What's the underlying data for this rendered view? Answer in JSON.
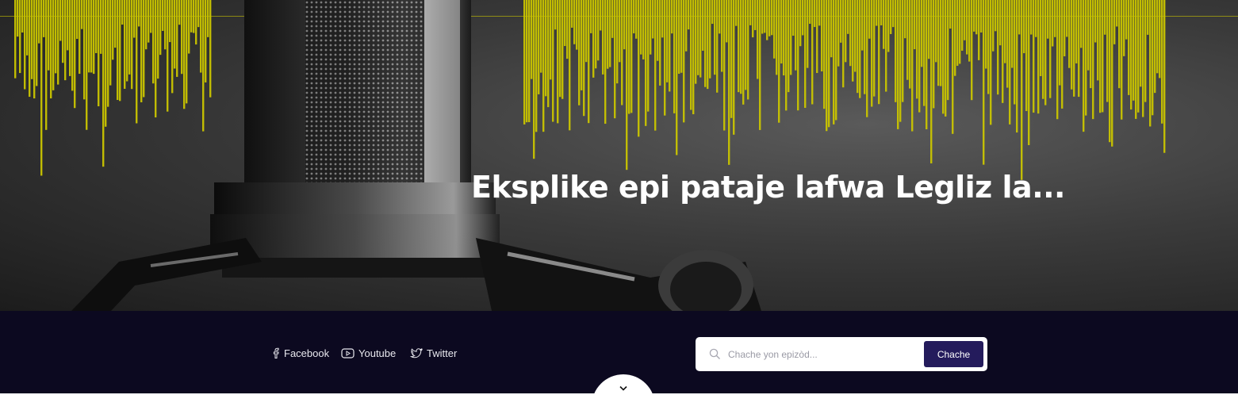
{
  "hero": {
    "title": "Eksplike epi pataje lafwa Legliz la...",
    "background": "microphone-waveform-image",
    "waveform_color": "#c9c400"
  },
  "social_links": [
    {
      "label": "Facebook",
      "icon": "facebook-icon"
    },
    {
      "label": "Youtube",
      "icon": "youtube-icon"
    },
    {
      "label": "Twitter",
      "icon": "twitter-icon"
    }
  ],
  "search": {
    "placeholder": "Chache yon epizòd...",
    "button_label": "Chache",
    "icon": "search-icon"
  },
  "scroll_down": {
    "icon": "chevron-down-icon"
  },
  "colors": {
    "bar_background": "#0c0920",
    "button_background": "#241b5c",
    "text": "#ffffff"
  }
}
